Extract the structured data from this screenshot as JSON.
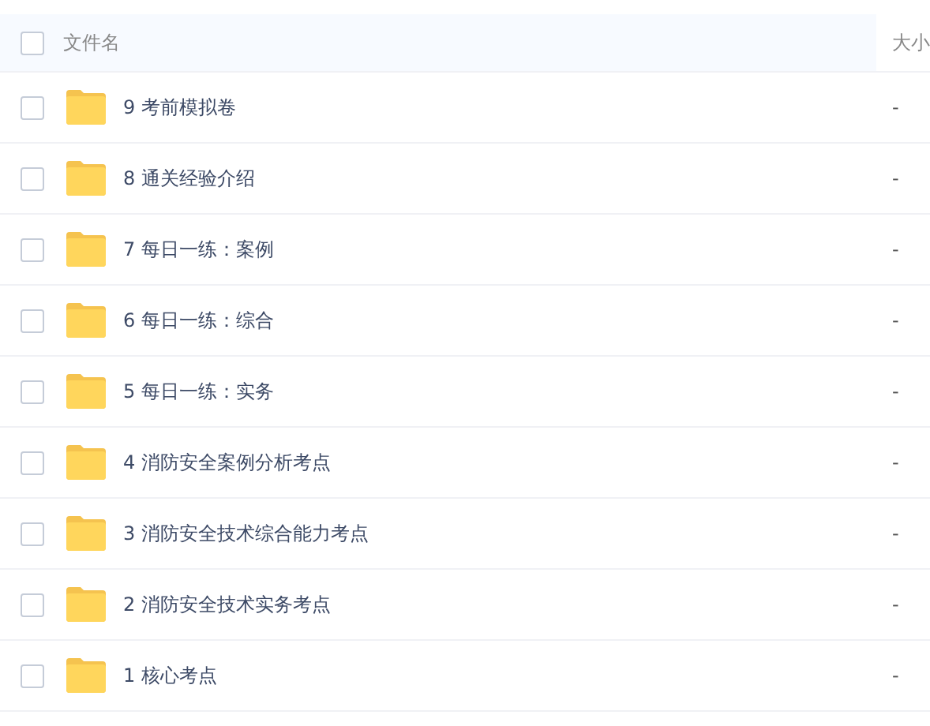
{
  "header": {
    "checked": false,
    "columns": [
      "文件名",
      "大小"
    ]
  },
  "rows": [
    {
      "name": "9 考前模拟卷",
      "size": "-",
      "checked": false
    },
    {
      "name": "8 通关经验介绍",
      "size": "-",
      "checked": false
    },
    {
      "name": "7 每日一练：案例",
      "size": "-",
      "checked": false
    },
    {
      "name": "6 每日一练：综合",
      "size": "-",
      "checked": false
    },
    {
      "name": "5 每日一练：实务",
      "size": "-",
      "checked": false
    },
    {
      "name": "4 消防安全案例分析考点",
      "size": "-",
      "checked": false
    },
    {
      "name": "3 消防安全技术综合能力考点",
      "size": "-",
      "checked": false
    },
    {
      "name": "2 消防安全技术实务考点",
      "size": "-",
      "checked": false
    },
    {
      "name": "1 核心考点",
      "size": "-",
      "checked": false
    }
  ]
}
